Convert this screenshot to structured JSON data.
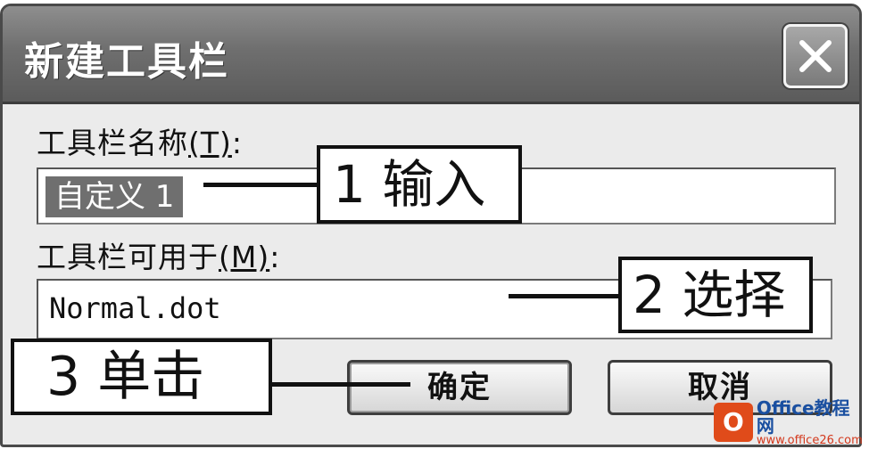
{
  "dialog": {
    "title": "新建工具栏",
    "close_icon": "close-x-icon",
    "name_label": "工具栏名称",
    "name_label_access": "(T)",
    "name_label_suffix": ":",
    "name_value": "自定义 1",
    "avail_label": "工具栏可用于",
    "avail_label_access": "(M)",
    "avail_label_suffix": ":",
    "avail_value": "Normal.dot",
    "ok_label": "确定",
    "cancel_label": "取消"
  },
  "annotations": {
    "step1": "1 输入",
    "step2": "2 选择",
    "step3": "3 单击"
  },
  "watermark": {
    "logo_letter": "O",
    "top": "Office教程网",
    "bottom": "www.office26.com"
  },
  "colors": {
    "titlebar": "#6f6f6f",
    "selection": "#6f6f6f",
    "watermark_logo": "#e04b1a",
    "watermark_text": "#1a4fa0"
  }
}
